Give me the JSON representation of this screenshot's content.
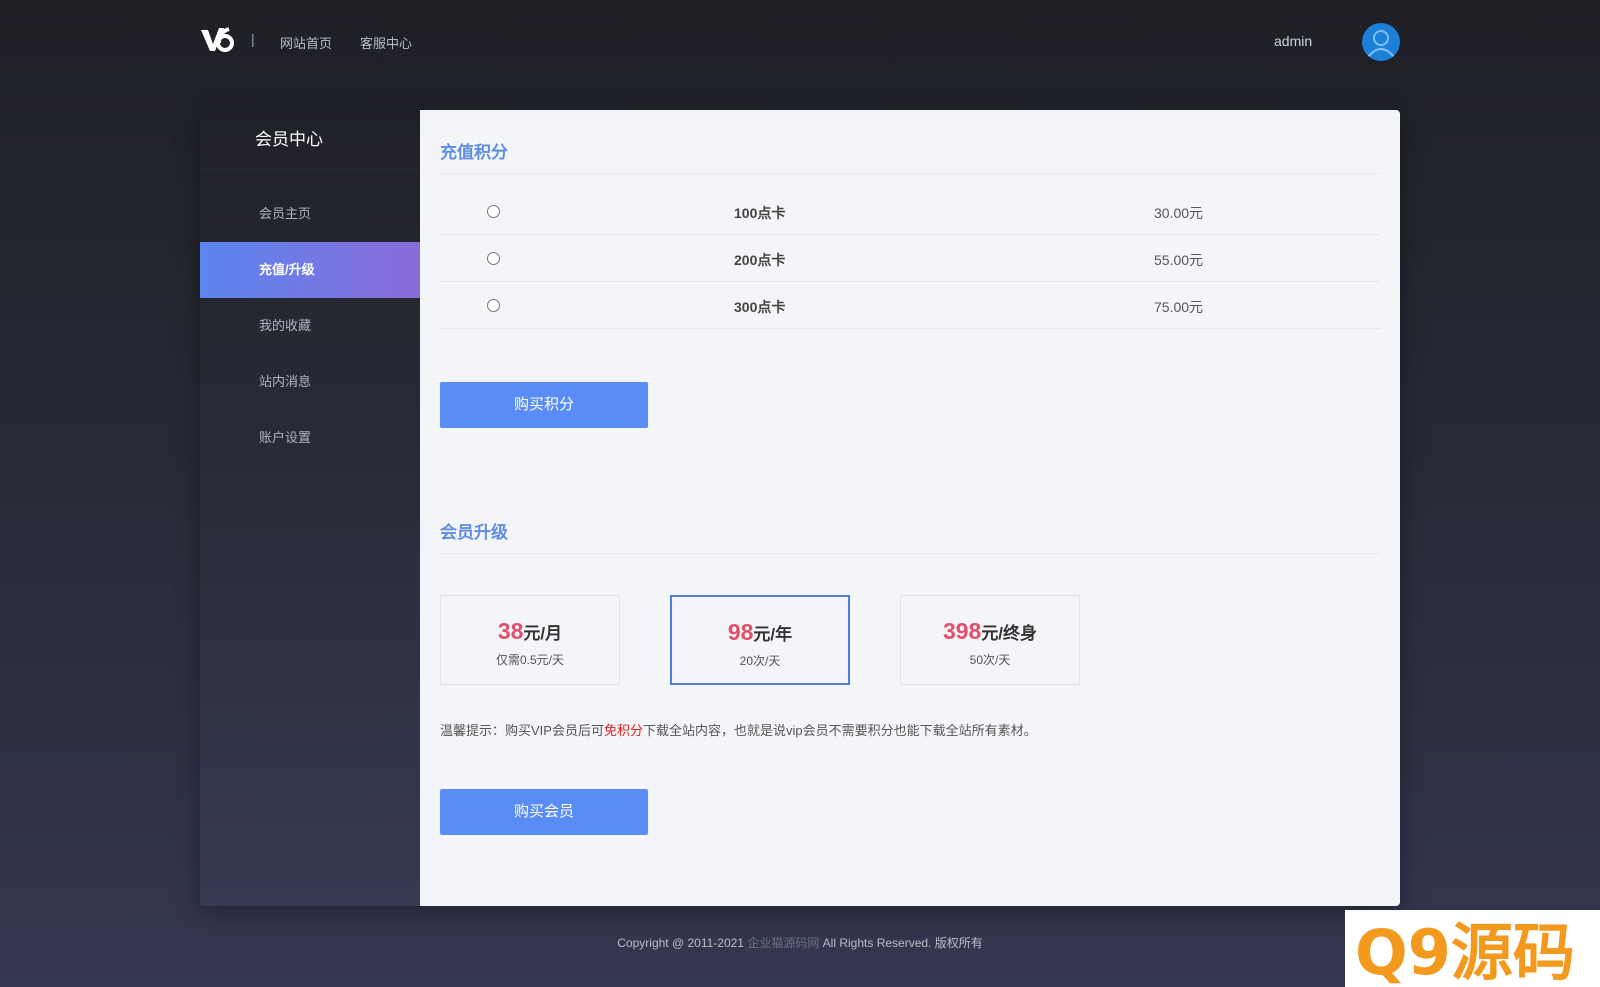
{
  "header": {
    "logo_text": "v6",
    "separator": "|",
    "nav_home": "网站首页",
    "nav_service": "客服中心",
    "username": "admin"
  },
  "sidebar": {
    "title": "会员中心",
    "items": [
      {
        "label": "会员主页",
        "active": false
      },
      {
        "label": "充值/升级",
        "active": true
      },
      {
        "label": "我的收藏",
        "active": false
      },
      {
        "label": "站内消息",
        "active": false
      },
      {
        "label": "账户设置",
        "active": false
      }
    ]
  },
  "recharge": {
    "title": "充值积分",
    "options": [
      {
        "name": "100点卡",
        "price": "30.00元"
      },
      {
        "name": "200点卡",
        "price": "55.00元"
      },
      {
        "name": "300点卡",
        "price": "75.00元"
      }
    ],
    "buy_label": "购买积分"
  },
  "upgrade": {
    "title": "会员升级",
    "plans": [
      {
        "amount": "38",
        "unit": "元/月",
        "note": "仅需0.5元/天",
        "selected": false
      },
      {
        "amount": "98",
        "unit": "元/年",
        "note": "20次/天",
        "selected": true
      },
      {
        "amount": "398",
        "unit": "元/终身",
        "note": "50次/天",
        "selected": false
      }
    ],
    "tip_prefix": "温馨提示：购买VIP会员后可",
    "tip_highlight": "免积分",
    "tip_suffix": "下载全站内容，也就是说vip会员不需要积分也能下载全站所有素材。",
    "buy_label": "购买会员"
  },
  "footer": {
    "copyright_prefix": "Copyright @ 2011-2021",
    "site_name": "企业猫源码网",
    "copyright_suffix": "All Rights Reserved. 版权所有"
  },
  "watermark": {
    "text": "Q9源码"
  },
  "colors": {
    "accent": "#5a8cf5",
    "section_title": "#5f8ee0",
    "price_highlight": "#e0506a",
    "tip_highlight": "#e02020",
    "active_nav_start": "#5b86f0",
    "active_nav_end": "#8a6bd8"
  }
}
